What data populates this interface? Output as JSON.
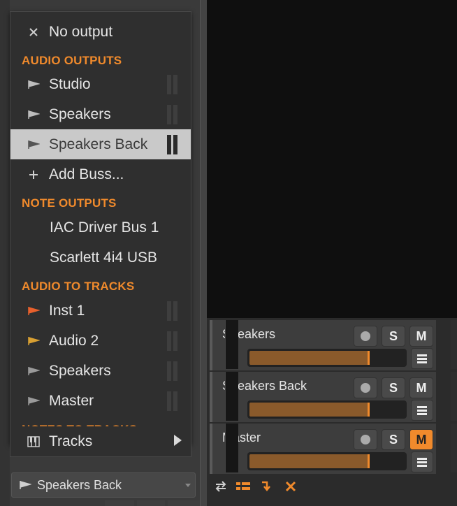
{
  "menu": {
    "no_output": "No output",
    "sections": {
      "audio_outputs": "AUDIO OUTPUTS",
      "note_outputs": "NOTE OUTPUTS",
      "audio_to_tracks": "AUDIO TO TRACKS",
      "notes_to_tracks": "NOTES TO TRACKS"
    },
    "audio_outputs": [
      {
        "label": "Studio",
        "icon": "output-flag-icon"
      },
      {
        "label": "Speakers",
        "icon": "output-flag-icon"
      },
      {
        "label": "Speakers Back",
        "icon": "output-flag-icon",
        "selected": true
      }
    ],
    "add_buss": "Add Buss...",
    "note_outputs": [
      {
        "label": "IAC Driver Bus 1"
      },
      {
        "label": "Scarlett 4i4 USB"
      }
    ],
    "audio_to_tracks": [
      {
        "label": "Inst 1",
        "color": "#e8602c"
      },
      {
        "label": "Audio 2",
        "color": "#d9a032"
      },
      {
        "label": "Speakers",
        "color": "#9a9a9a"
      },
      {
        "label": "Master",
        "color": "#9a9a9a"
      }
    ],
    "notes_to_tracks": [
      {
        "label": "Tracks",
        "has_submenu": true
      }
    ]
  },
  "output_selector": {
    "value": "Speakers Back"
  },
  "tracks": [
    {
      "name": "Speakers",
      "icon": "routing-arrow-icon",
      "solo": "S",
      "mute": "M",
      "mute_on": false,
      "fader": 0.77
    },
    {
      "name": "Speakers Back",
      "icon": "routing-arrow-icon",
      "solo": "S",
      "mute": "M",
      "mute_on": false,
      "fader": 0.77
    },
    {
      "name": "Master",
      "icon": "crown-icon",
      "solo": "S",
      "mute": "M",
      "mute_on": true,
      "fader": 0.77
    }
  ],
  "colors": {
    "accent": "#f08a2c",
    "menu_bg": "#2f2f2f",
    "selected_bg": "#c9c9c9"
  }
}
